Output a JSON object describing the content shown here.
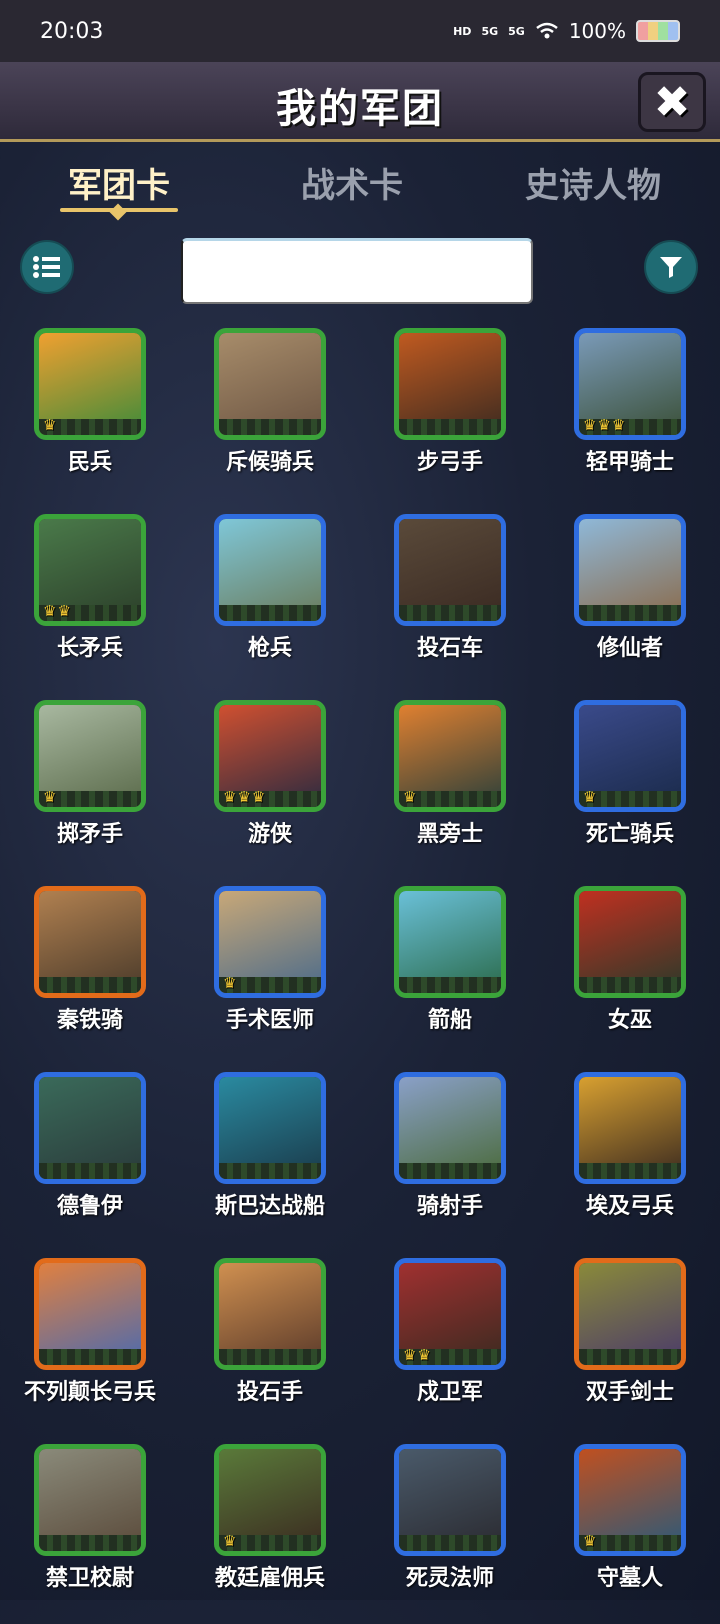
{
  "status": {
    "time": "20:03",
    "hd": "HD",
    "net1": "5G",
    "net2": "5G",
    "battery": "100%"
  },
  "header": {
    "title": "我的军团"
  },
  "tabs": [
    "军团卡",
    "战术卡",
    "史诗人物"
  ],
  "search": {
    "placeholder": ""
  },
  "cards": [
    {
      "name": "民兵",
      "rarity": "green",
      "crowns": 1,
      "art": [
        "#f0a030",
        "#3d8a3a"
      ]
    },
    {
      "name": "斥候骑兵",
      "rarity": "green",
      "crowns": 0,
      "art": [
        "#a78c6a",
        "#6b5442"
      ]
    },
    {
      "name": "步弓手",
      "rarity": "green",
      "crowns": 0,
      "art": [
        "#c05a20",
        "#3b2a20"
      ]
    },
    {
      "name": "轻甲骑士",
      "rarity": "blue",
      "crowns": 3,
      "art": [
        "#7a9ab8",
        "#3a4f36"
      ]
    },
    {
      "name": "长矛兵",
      "rarity": "green",
      "crowns": 2,
      "art": [
        "#4a7a4a",
        "#2c3f2a"
      ]
    },
    {
      "name": "枪兵",
      "rarity": "blue",
      "crowns": 0,
      "art": [
        "#7fc7d8",
        "#6a7a5a"
      ]
    },
    {
      "name": "投石车",
      "rarity": "blue",
      "crowns": 0,
      "art": [
        "#5a4a3a",
        "#3a2a22"
      ]
    },
    {
      "name": "修仙者",
      "rarity": "blue",
      "crowns": 0,
      "art": [
        "#8fb8d8",
        "#8a6a4a"
      ]
    },
    {
      "name": "掷矛手",
      "rarity": "green",
      "crowns": 1,
      "art": [
        "#a8b8a0",
        "#5a6a4a"
      ]
    },
    {
      "name": "游侠",
      "rarity": "green",
      "crowns": 3,
      "art": [
        "#d05030",
        "#2a2a40"
      ]
    },
    {
      "name": "黑旁士",
      "rarity": "green",
      "crowns": 1,
      "art": [
        "#e08030",
        "#2a3f3a"
      ]
    },
    {
      "name": "死亡骑兵",
      "rarity": "blue",
      "crowns": 1,
      "art": [
        "#3a4a8a",
        "#1a2a4a"
      ]
    },
    {
      "name": "秦铁骑",
      "rarity": "orange",
      "crowns": 0,
      "art": [
        "#b08050",
        "#4a3a2a"
      ]
    },
    {
      "name": "手术医师",
      "rarity": "blue",
      "crowns": 1,
      "art": [
        "#c8a878",
        "#4a6a8a"
      ]
    },
    {
      "name": "箭船",
      "rarity": "green",
      "crowns": 0,
      "art": [
        "#6ac0d8",
        "#2a6a4a"
      ]
    },
    {
      "name": "女巫",
      "rarity": "green",
      "crowns": 0,
      "art": [
        "#c03020",
        "#2a3a2a"
      ]
    },
    {
      "name": "德鲁伊",
      "rarity": "blue",
      "crowns": 0,
      "art": [
        "#3a6a5a",
        "#2a3a3a"
      ]
    },
    {
      "name": "斯巴达战船",
      "rarity": "blue",
      "crowns": 0,
      "art": [
        "#2a8aa0",
        "#1a3a4a"
      ]
    },
    {
      "name": "骑射手",
      "rarity": "blue",
      "crowns": 0,
      "art": [
        "#8aa0c8",
        "#4a6a3a"
      ]
    },
    {
      "name": "埃及弓兵",
      "rarity": "blue",
      "crowns": 0,
      "art": [
        "#d8a030",
        "#3a2a20"
      ]
    },
    {
      "name": "不列颠长弓兵",
      "rarity": "orange",
      "crowns": 0,
      "art": [
        "#e08040",
        "#4a6ab0"
      ]
    },
    {
      "name": "投石手",
      "rarity": "green",
      "crowns": 0,
      "art": [
        "#d09050",
        "#5a3a2a"
      ]
    },
    {
      "name": "戍卫军",
      "rarity": "blue",
      "crowns": 2,
      "art": [
        "#a03030",
        "#3a2a20"
      ]
    },
    {
      "name": "双手剑士",
      "rarity": "orange",
      "crowns": 0,
      "art": [
        "#8a8a3a",
        "#4a3a6a"
      ]
    },
    {
      "name": "禁卫校尉",
      "rarity": "green",
      "crowns": 0,
      "art": [
        "#8a8a7a",
        "#5a4a3a"
      ]
    },
    {
      "name": "教廷雇佣兵",
      "rarity": "green",
      "crowns": 1,
      "art": [
        "#5a7a3a",
        "#3a2a20"
      ]
    },
    {
      "name": "死灵法师",
      "rarity": "blue",
      "crowns": 0,
      "art": [
        "#4a5a6a",
        "#2a2a30"
      ]
    },
    {
      "name": "守墓人",
      "rarity": "blue",
      "crowns": 1,
      "art": [
        "#c05020",
        "#2a5a7a"
      ]
    }
  ]
}
